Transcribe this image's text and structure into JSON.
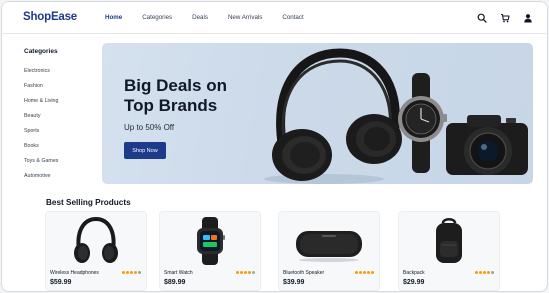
{
  "header": {
    "logo": "ShopEase",
    "nav": [
      {
        "label": "Home",
        "active": true
      },
      {
        "label": "Categories",
        "active": false
      },
      {
        "label": "Deals",
        "active": false
      },
      {
        "label": "New Arrivals",
        "active": false
      },
      {
        "label": "Contact",
        "active": false
      }
    ],
    "icons": [
      "search-icon",
      "cart-icon",
      "user-icon"
    ]
  },
  "sidebar": {
    "title": "Categories",
    "items": [
      "Electronics",
      "Fashion",
      "Home & Living",
      "Beauty",
      "Sports",
      "Books",
      "Toys & Games",
      "Automotive"
    ]
  },
  "hero": {
    "title_line1": "Big Deals on",
    "title_line2": "Top Brands",
    "subtitle": "Up to 50% Off",
    "button_label": "Shop Now",
    "illustration": [
      "headphones-image",
      "watch-image",
      "camera-image"
    ]
  },
  "best_selling": {
    "title": "Best Selling Products",
    "products": [
      {
        "name": "Wireless Headphones",
        "price": "$59.99",
        "image": "headphones-image"
      },
      {
        "name": "Smart Watch",
        "price": "$89.99",
        "image": "smartwatch-image"
      },
      {
        "name": "Bluetooth Speaker",
        "price": "$39.99",
        "image": "speaker-image"
      },
      {
        "name": "Backpack",
        "price": "$29.99",
        "image": "backpack-image"
      }
    ]
  },
  "colors": {
    "brand": "#1e3a8a",
    "hero_bg": "#cbd9e9",
    "rating_star": "#f59e0b"
  }
}
